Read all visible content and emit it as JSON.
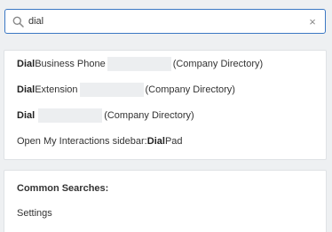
{
  "search": {
    "value": "dial",
    "clear_icon": "close-icon",
    "search_icon": "search-icon"
  },
  "results": [
    {
      "bold": "Dial",
      "text": " Business Phone",
      "suffix": "(Company Directory)"
    },
    {
      "bold": "Dial",
      "text": " Extension",
      "suffix": "(Company Directory)"
    },
    {
      "bold": "Dial",
      "text": "",
      "suffix": "(Company Directory)"
    },
    {
      "prefix": "Open My Interactions sidebar: ",
      "bold": "Dial",
      "text": " Pad"
    }
  ],
  "common_searches": {
    "title": "Common Searches:",
    "items": [
      "Settings"
    ]
  },
  "colors": {
    "accent": "#3b78c4",
    "background": "#eef0f2",
    "redacted": "#eceef0"
  }
}
